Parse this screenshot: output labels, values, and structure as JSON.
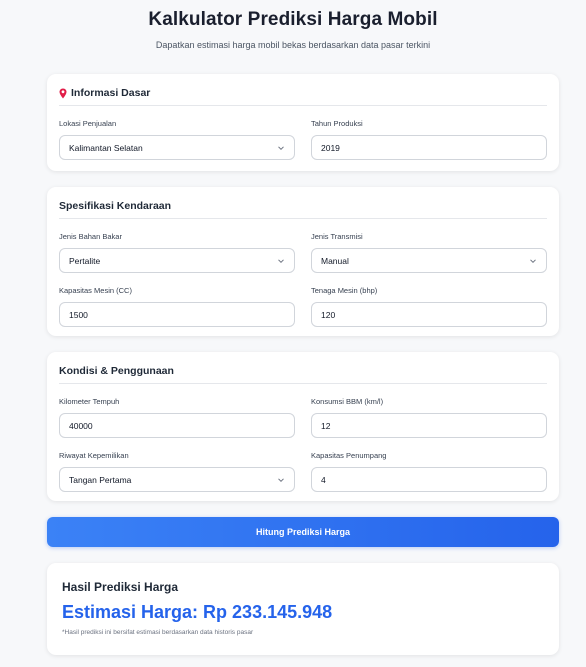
{
  "header": {
    "title": "Kalkulator Prediksi Harga Mobil",
    "subtitle": "Dapatkan estimasi harga mobil bekas berdasarkan data pasar terkini"
  },
  "sections": {
    "basic": {
      "icon": "pin-icon",
      "title": "Informasi Dasar",
      "location_label": "Lokasi Penjualan",
      "location_value": "Kalimantan Selatan",
      "year_label": "Tahun Produksi",
      "year_value": "2019"
    },
    "spec": {
      "title": "Spesifikasi Kendaraan",
      "fuel_label": "Jenis Bahan Bakar",
      "fuel_value": "Pertalite",
      "transmission_label": "Jenis Transmisi",
      "transmission_value": "Manual",
      "engine_label": "Kapasitas Mesin (CC)",
      "engine_value": "1500",
      "power_label": "Tenaga Mesin (bhp)",
      "power_value": "120"
    },
    "condition": {
      "title": "Kondisi & Penggunaan",
      "km_label": "Kilometer Tempuh",
      "km_value": "40000",
      "consumption_label": "Konsumsi BBM (km/l)",
      "consumption_value": "12",
      "ownership_label": "Riwayat Kepemilikan",
      "ownership_value": "Tangan Pertama",
      "seats_label": "Kapasitas Penumpang",
      "seats_value": "4"
    }
  },
  "action": {
    "button_label": "Hitung Prediksi Harga"
  },
  "result": {
    "title": "Hasil Prediksi Harga",
    "value": "Estimasi Harga: Rp 233.145.948",
    "note": "*Hasil prediksi ini bersifat estimasi berdasarkan data historis pasar"
  },
  "colors": {
    "accent": "#2563eb",
    "pin": "#e11d48"
  }
}
